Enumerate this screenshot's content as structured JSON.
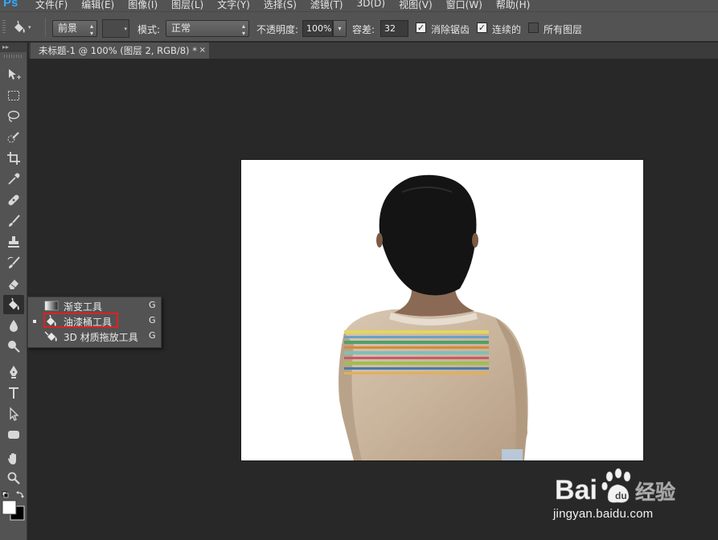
{
  "app": {
    "logo": "Ps",
    "menu": [
      "文件(F)",
      "编辑(E)",
      "图像(I)",
      "图层(L)",
      "文字(Y)",
      "选择(S)",
      "滤镜(T)",
      "3D(D)",
      "视图(V)",
      "窗口(W)",
      "帮助(H)"
    ]
  },
  "options": {
    "fill_source": "前景",
    "mode_label": "模式:",
    "mode_value": "正常",
    "opacity_label": "不透明度:",
    "opacity_value": "100%",
    "tolerance_label": "容差:",
    "tolerance_value": "32",
    "antialias_label": "消除锯齿",
    "antialias_checked": true,
    "contiguous_label": "连续的",
    "contiguous_checked": true,
    "all_layers_label": "所有图层",
    "all_layers_checked": false
  },
  "document": {
    "tab_title": "未标题-1 @ 100% (图层 2, RGB/8) *",
    "close": "×"
  },
  "flyout": {
    "items": [
      {
        "label": "渐变工具",
        "shortcut": "G",
        "selected": false,
        "icon": "gradient-icon"
      },
      {
        "label": "油漆桶工具",
        "shortcut": "G",
        "selected": true,
        "icon": "paint-bucket-icon"
      },
      {
        "label": "3D 材质拖放工具",
        "shortcut": "G",
        "selected": false,
        "icon": "3d-material-drop-icon"
      }
    ],
    "highlight_color": "#e02020"
  },
  "watermark": {
    "brand": "Bai",
    "brand_suffix": "经验",
    "url": "jingyan.baidu.com"
  },
  "colors": {
    "accent_blue": "#31a8ff",
    "panel": "#535353",
    "workspace": "#282828"
  }
}
